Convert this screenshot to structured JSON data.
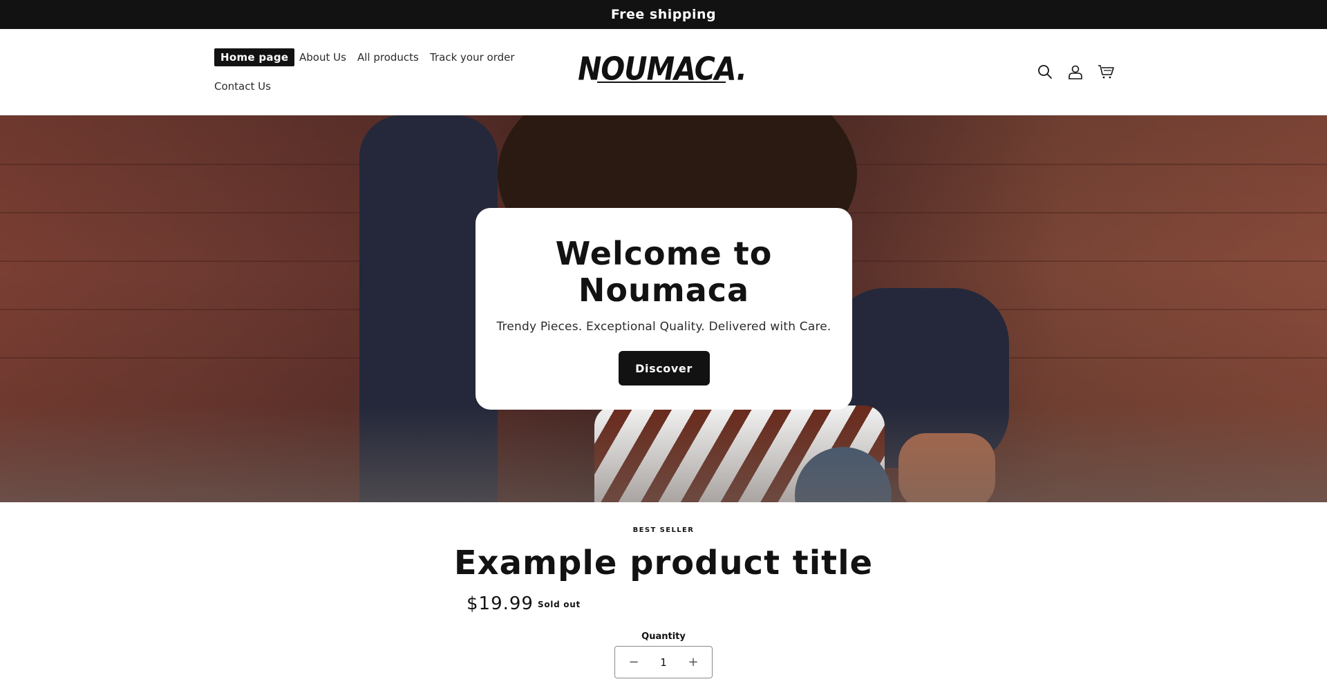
{
  "announcement": {
    "text": "Free shipping"
  },
  "header": {
    "nav": {
      "home": "Home page",
      "about": "About Us",
      "products": "All products",
      "track": "Track your order",
      "contact": "Contact Us"
    },
    "logo_text": "NOUMACA.",
    "icons": [
      "search-icon",
      "account-icon",
      "cart-icon"
    ]
  },
  "hero": {
    "title": "Welcome to Noumaca",
    "subtitle": "Trendy Pieces. Exceptional Quality. Delivered with Care.",
    "button_label": "Discover"
  },
  "product": {
    "eyebrow": "BEST SELLER",
    "title": "Example product title",
    "price": "$19.99",
    "status": "Sold out",
    "quantity_label": "Quantity",
    "quantity_value": "1",
    "decrease_symbol": "−",
    "increase_symbol": "+"
  },
  "colors": {
    "dark": "#121212",
    "white": "#ffffff"
  }
}
